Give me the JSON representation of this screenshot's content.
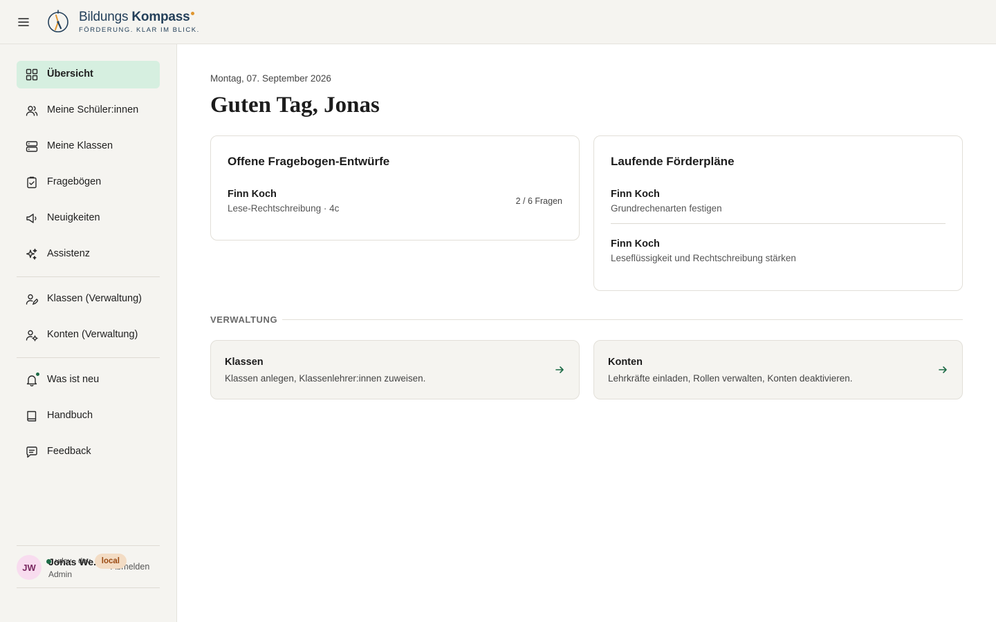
{
  "brand": {
    "name_part1": "Bildungs",
    "name_part2": "Kompass",
    "tagline": "FÖRDERUNG. KLAR IM BLICK."
  },
  "sidebar": {
    "items": [
      {
        "label": "Übersicht",
        "icon": "grid-icon",
        "active": true
      },
      {
        "label": "Meine Schüler:innen",
        "icon": "users-icon"
      },
      {
        "label": "Meine Klassen",
        "icon": "stack-icon"
      },
      {
        "label": "Fragebögen",
        "icon": "clipboard-icon"
      },
      {
        "label": "Neuigkeiten",
        "icon": "megaphone-icon"
      },
      {
        "label": "Assistenz",
        "icon": "sparkles-icon"
      },
      {
        "label": "Klassen (Verwaltung)",
        "icon": "user-edit-icon"
      },
      {
        "label": "Konten (Verwaltung)",
        "icon": "user-cog-icon"
      },
      {
        "label": "Was ist neu",
        "icon": "bell-icon",
        "badge": true
      },
      {
        "label": "Handbuch",
        "icon": "book-icon"
      },
      {
        "label": "Feedback",
        "icon": "message-icon"
      }
    ],
    "user": {
      "initials": "JW",
      "name": "Jonas We...",
      "role": "Admin",
      "logout_label": "Abmelden"
    },
    "env": {
      "text": "vdev · dev",
      "pill": "local"
    }
  },
  "main": {
    "date": "Montag, 07. September 2026",
    "greeting": "Guten Tag, Jonas",
    "drafts_card": {
      "title": "Offene Fragebogen-Entwürfe",
      "entries": [
        {
          "name": "Finn Koch",
          "sub": "Lese-Rechtschreibung · 4c",
          "right": "2 / 6 Fragen"
        }
      ]
    },
    "plans_card": {
      "title": "Laufende Förderpläne",
      "entries": [
        {
          "name": "Finn Koch",
          "sub": "Grundrechenarten festigen"
        },
        {
          "name": "Finn Koch",
          "sub": "Leseflüssigkeit und Rechtschreibung stärken"
        }
      ]
    },
    "admin": {
      "section_label": "VERWALTUNG",
      "cards": [
        {
          "title": "Klassen",
          "desc": "Klassen anlegen, Klassenlehrer:innen zuweisen."
        },
        {
          "title": "Konten",
          "desc": "Lehrkräfte einladen, Rollen verwalten, Konten deaktivieren."
        }
      ]
    }
  },
  "colors": {
    "accent_green": "#1c6b46",
    "active_nav_bg": "#d6efe0",
    "brand_navy": "#24405a",
    "brand_orange": "#e0962f",
    "sidebar_bg": "#f5f4f0"
  }
}
